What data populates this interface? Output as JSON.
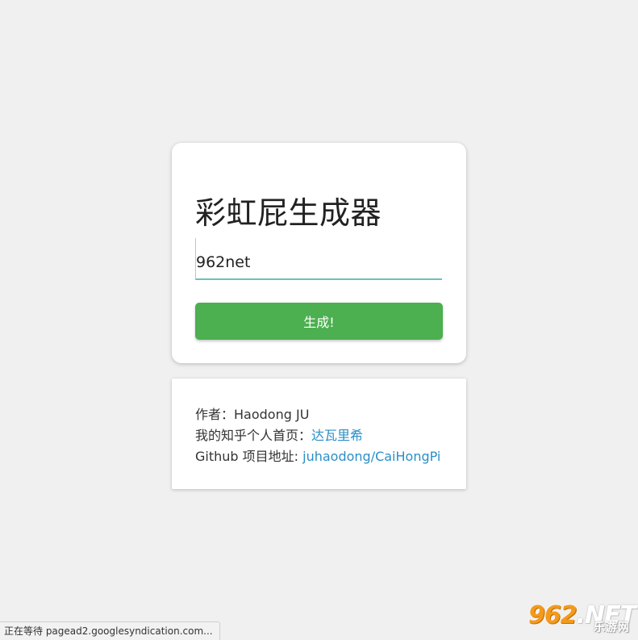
{
  "main_card": {
    "title": "彩虹屁生成器",
    "input_value": "962net",
    "button_label": "生成!"
  },
  "info_card": {
    "author_label": "作者：",
    "author_name": "Haodong JU",
    "zhihu_label": "我的知乎个人首页：",
    "zhihu_link_text": "达瓦里希",
    "github_label": "Github 项目地址: ",
    "github_link_text": "juhaodong/CaiHongPi"
  },
  "status_bar": {
    "text": "正在等待 pagead2.googlesyndication.com..."
  },
  "watermark": {
    "number": "962",
    "domain": ".NET",
    "site_name": "乐游网"
  },
  "colors": {
    "background": "#f0f0f0",
    "button": "#4caf50",
    "link": "#2a8fc7",
    "input_underline": "#6fbfb4"
  }
}
